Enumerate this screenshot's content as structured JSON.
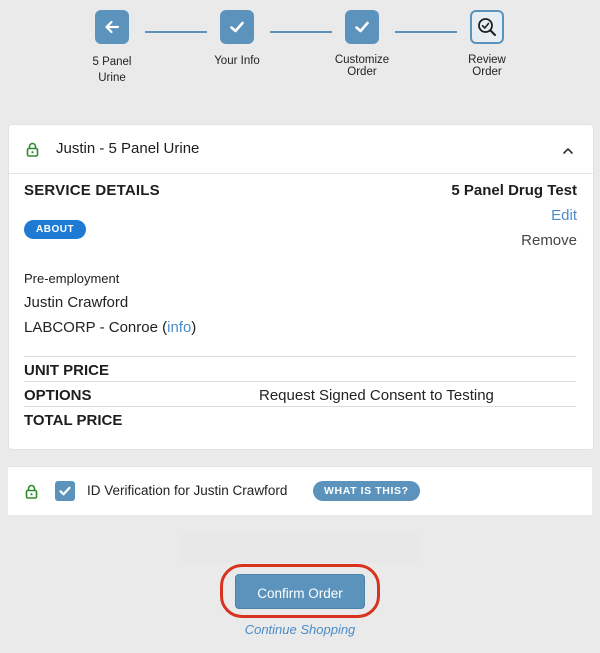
{
  "stepper": {
    "steps": [
      {
        "label": "5 Panel\nUrine",
        "icon": "arrow-left-icon",
        "state": "back"
      },
      {
        "label": "Your Info",
        "icon": "check-icon",
        "state": "done"
      },
      {
        "label": "Customize\nOrder",
        "icon": "check-icon",
        "state": "done"
      },
      {
        "label": "Review\nOrder",
        "icon": "search-check-icon",
        "state": "current"
      }
    ]
  },
  "order_card": {
    "title": "Justin - 5 Panel Urine",
    "lock_icon": "lock-icon",
    "collapse_icon": "chevron-up-icon",
    "service_details_heading": "SERVICE DETAILS",
    "product_name": "5 Panel Drug Test",
    "edit_label": "Edit",
    "remove_label": "Remove",
    "about_label": "ABOUT",
    "reason": "Pre-employment",
    "person": "Justin Crawford",
    "lab_prefix": "LABCORP - Conroe (",
    "lab_link": "info",
    "lab_suffix": ")",
    "rows": [
      {
        "key": "UNIT PRICE",
        "value": ""
      },
      {
        "key": "OPTIONS",
        "value": "Request Signed Consent to Testing"
      },
      {
        "key": "TOTAL PRICE",
        "value": ""
      }
    ]
  },
  "id_verification": {
    "label": "ID Verification for Justin Crawford",
    "checked": true,
    "what_label": "WHAT IS THIS?"
  },
  "actions": {
    "confirm_label": "Confirm Order",
    "continue_label": "Continue Shopping"
  },
  "colors": {
    "accent": "#5b93bd",
    "link": "#4b8cc8",
    "badge": "#1f7ad3",
    "highlight_ring": "#d8331e",
    "lock": "#2f8a2f"
  }
}
